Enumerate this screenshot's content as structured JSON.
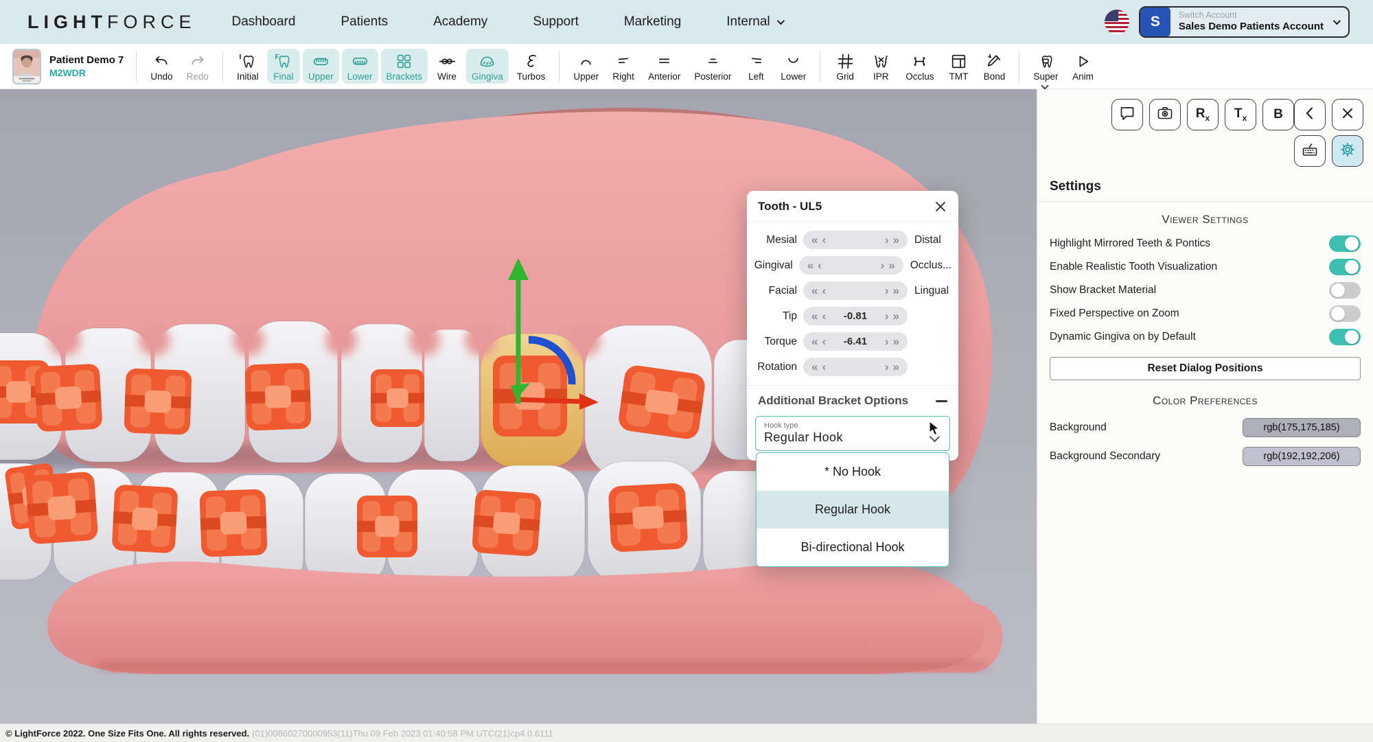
{
  "topnav": {
    "logo_light": "LIGHT",
    "logo_force": "FORCE",
    "items": [
      "Dashboard",
      "Patients",
      "Academy",
      "Support",
      "Marketing"
    ],
    "internal_label": "Internal",
    "account": {
      "avatar_letter": "S",
      "switch_label": "Switch Account",
      "account_name": "Sales Demo Patients Account"
    }
  },
  "toolbar": {
    "patient_name": "Patient Demo 7",
    "patient_id": "M2WDR",
    "groups": [
      {
        "buttons": [
          {
            "label": "Undo",
            "icon": "undo-icon"
          },
          {
            "label": "Redo",
            "icon": "redo-icon",
            "disabled": true
          }
        ]
      },
      {
        "buttons": [
          {
            "label": "Initial",
            "icon": "tooth-initial-icon"
          },
          {
            "label": "Final",
            "icon": "tooth-final-icon",
            "active": true
          },
          {
            "label": "Upper",
            "icon": "upper-arch-icon",
            "active": true
          },
          {
            "label": "Lower",
            "icon": "lower-arch-icon",
            "active": true
          },
          {
            "label": "Brackets",
            "icon": "brackets-icon",
            "active": true
          },
          {
            "label": "Wire",
            "icon": "wire-icon"
          },
          {
            "label": "Gingiva",
            "icon": "gingiva-icon",
            "active": true
          },
          {
            "label": "Turbos",
            "icon": "turbos-icon"
          }
        ]
      },
      {
        "buttons": [
          {
            "label": "Upper",
            "icon": "view-upper-icon"
          },
          {
            "label": "Right",
            "icon": "view-right-icon"
          },
          {
            "label": "Anterior",
            "icon": "view-anterior-icon"
          },
          {
            "label": "Posterior",
            "icon": "view-posterior-icon"
          },
          {
            "label": "Left",
            "icon": "view-left-icon"
          },
          {
            "label": "Lower",
            "icon": "view-lower-icon"
          }
        ]
      },
      {
        "buttons": [
          {
            "label": "Grid",
            "icon": "grid-icon"
          },
          {
            "label": "IPR",
            "icon": "ipr-icon"
          },
          {
            "label": "Occlus",
            "icon": "occlus-icon"
          },
          {
            "label": "TMT",
            "icon": "tmt-icon"
          },
          {
            "label": "Bond",
            "icon": "bond-icon"
          }
        ]
      },
      {
        "buttons": [
          {
            "label": "Super",
            "icon": "super-icon",
            "caret": true
          },
          {
            "label": "Anim",
            "icon": "anim-icon"
          }
        ]
      }
    ]
  },
  "dialog": {
    "title": "Tooth - UL5",
    "rows": [
      {
        "left": "Mesial",
        "value": "",
        "right": "Distal"
      },
      {
        "left": "Gingival",
        "value": "",
        "right": "Occlus..."
      },
      {
        "left": "Facial",
        "value": "",
        "right": "Lingual"
      },
      {
        "left": "Tip",
        "value": "-0.81",
        "right": ""
      },
      {
        "left": "Torque",
        "value": "-6.41",
        "right": ""
      },
      {
        "left": "Rotation",
        "value": "",
        "right": ""
      }
    ],
    "section_title": "Additional Bracket Options",
    "hook_label": "Hook type",
    "hook_value": "Regular Hook",
    "hook_options": [
      "* No Hook",
      "Regular Hook",
      "Bi-directional Hook"
    ],
    "hook_selected": "Regular Hook"
  },
  "panel": {
    "title": "Settings",
    "viewer_heading": "Viewer Settings",
    "toggles": [
      {
        "label": "Highlight Mirrored Teeth & Pontics",
        "on": true
      },
      {
        "label": "Enable Realistic Tooth Visualization",
        "on": true
      },
      {
        "label": "Show Bracket Material",
        "on": false
      },
      {
        "label": "Fixed Perspective on Zoom",
        "on": false
      },
      {
        "label": "Dynamic Gingiva on by Default",
        "on": true
      }
    ],
    "reset_label": "Reset Dialog Positions",
    "color_heading": "Color Preferences",
    "colors": [
      {
        "label": "Background",
        "value": "rgb(175,175,185)"
      },
      {
        "label": "Background Secondary",
        "value": "rgb(192,192,206)"
      }
    ]
  },
  "statusbar": {
    "copyright": "© LightForce 2022. One Size Fits One. All rights reserved.",
    "meta": "(01)00860270000953(11)Thu 09 Feb 2023 01:40:58 PM UTC(21)cp4.0.6111"
  },
  "colors": {
    "accent_teal": "#2f9e96",
    "toggle_on": "#3fbfb1",
    "bracket_orange": "#f15c30",
    "gum_pink": "#f0a4a4",
    "selected_tooth": "#e9c276",
    "viewer_background": "#adadb9"
  }
}
